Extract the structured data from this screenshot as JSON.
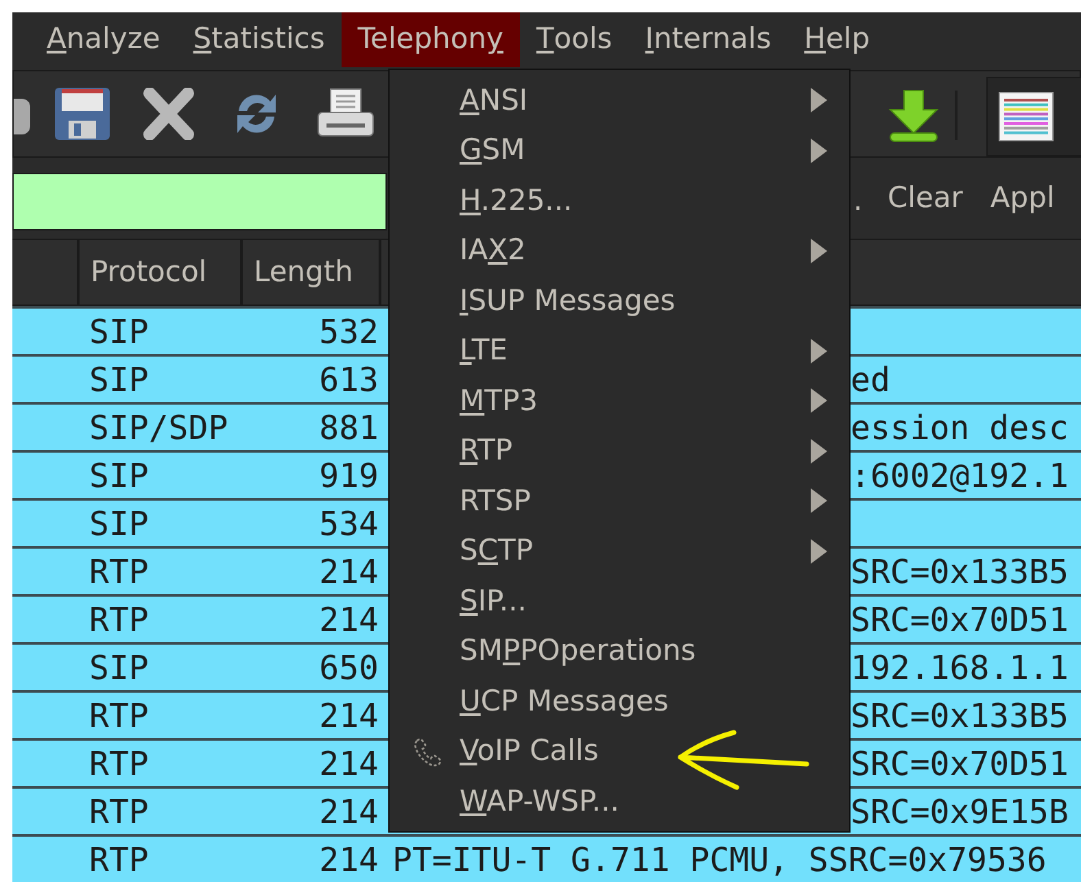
{
  "menubar": [
    {
      "key": "A",
      "after": "nalyze",
      "selected": false
    },
    {
      "key": "S",
      "after": "tatistics",
      "selected": false
    },
    {
      "before": "Telephon",
      "key": "y",
      "selected": true
    },
    {
      "key": "T",
      "after": "ools",
      "selected": false
    },
    {
      "key": "I",
      "after": "nternals",
      "selected": false
    },
    {
      "key": "H",
      "after": "elp",
      "selected": false
    }
  ],
  "filter": {
    "valid": true,
    "cut_text": ".",
    "buttons": [
      "Clear",
      "Appl"
    ]
  },
  "table": {
    "columns": [
      "Protocol",
      "Length"
    ],
    "rows": [
      {
        "protocol": "SIP",
        "length": "532"
      },
      {
        "protocol": "SIP",
        "length": "613",
        "info": "ed"
      },
      {
        "protocol": "SIP/SDP",
        "length": "881",
        "info": "ession desc"
      },
      {
        "protocol": "SIP",
        "length": "919",
        "info": ":6002@192.1"
      },
      {
        "protocol": "SIP",
        "length": "534"
      },
      {
        "protocol": "RTP",
        "length": "214",
        "info": "SRC=0x133B5"
      },
      {
        "protocol": "RTP",
        "length": "214",
        "info": "SRC=0x70D51"
      },
      {
        "protocol": "SIP",
        "length": "650",
        "info": "192.168.1.1"
      },
      {
        "protocol": "RTP",
        "length": "214",
        "info": "SRC=0x133B5"
      },
      {
        "protocol": "RTP",
        "length": "214",
        "info": "SRC=0x70D51"
      },
      {
        "protocol": "RTP",
        "length": "214",
        "info": "SRC=0x9E15B"
      },
      {
        "protocol": "RTP",
        "length": "214",
        "info": "PT=ITU-T G.711 PCMU, SSRC=0x79536"
      }
    ]
  },
  "menu": {
    "items": [
      {
        "kind": "submenu",
        "key": "A",
        "after": "NSI"
      },
      {
        "kind": "submenu",
        "key": "G",
        "after": "SM"
      },
      {
        "kind": "item",
        "key": "H",
        "after": ".225..."
      },
      {
        "kind": "submenu",
        "before": "IA",
        "key": "X",
        "after": "2"
      },
      {
        "kind": "item",
        "key": "I",
        "after": "SUP Messages"
      },
      {
        "kind": "submenu",
        "key": "L",
        "after": "TE"
      },
      {
        "kind": "submenu",
        "key": "M",
        "after": "TP3"
      },
      {
        "kind": "submenu",
        "key": "R",
        "after": "TP"
      },
      {
        "kind": "submenu",
        "before": "RTSP"
      },
      {
        "kind": "submenu",
        "before": "S",
        "key": "C",
        "after": "TP"
      },
      {
        "kind": "item",
        "key": "S",
        "after": "IP..."
      },
      {
        "kind": "item",
        "before": "SM",
        "key": "P",
        "after": "POperations"
      },
      {
        "kind": "item",
        "key": "U",
        "after": "CP Messages"
      },
      {
        "kind": "phone",
        "key": "V",
        "after": "oIP Calls"
      },
      {
        "kind": "item",
        "key": "W",
        "after": "AP-WSP..."
      }
    ]
  }
}
